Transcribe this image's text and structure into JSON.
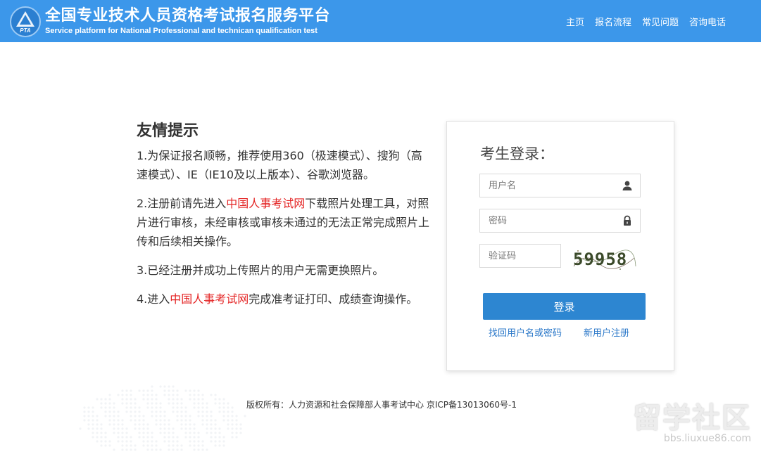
{
  "header": {
    "logo_text": "PTA",
    "title": "全国专业技术人员资格考试报名服务平台",
    "subtitle": "Service platform for National Professional and technican qualification test",
    "nav": [
      "主页",
      "报名流程",
      "常见问题",
      "咨询电话"
    ]
  },
  "notice": {
    "heading": "友情提示",
    "item1": "1.为保证报名顺畅，推荐使用360（极速模式）、搜狗（高速模式）、IE（IE10及以上版本）、谷歌浏览器。",
    "item2_pre": "2.注册前请先进入",
    "item2_link": "中国人事考试网",
    "item2_post": "下载照片处理工具，对照片进行审核，未经审核或审核未通过的无法正常完成照片上传和后续相关操作。",
    "item3": "3.已经注册并成功上传照片的用户无需更换照片。",
    "item4_pre": "4.进入",
    "item4_link": "中国人事考试网",
    "item4_post": "完成准考证打印、成绩查询操作。"
  },
  "login": {
    "title": "考生登录：",
    "username_placeholder": "用户名",
    "password_placeholder": "密码",
    "captcha_placeholder": "验证码",
    "captcha_text": "59958",
    "login_button": "登录",
    "forgot_link": "找回用户名或密码",
    "register_link": "新用户注册"
  },
  "footer": {
    "copyright": "版权所有：人力资源和社会保障部人事考试中心 京ICP备13013060号-1"
  },
  "watermark": {
    "big": "留学社区",
    "small": "bbs.liuxue86.com"
  },
  "colors": {
    "header_bg": "#3c97ea",
    "link_red": "#e42525",
    "button_blue": "#2d86d1",
    "link_blue": "#2b78c9"
  }
}
